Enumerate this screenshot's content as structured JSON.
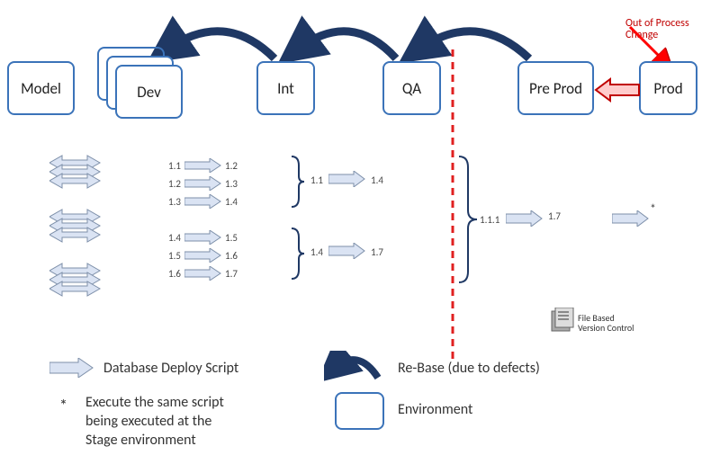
{
  "envs": {
    "model": "Model",
    "dev": "Dev",
    "int": "Int",
    "qa": "QA",
    "preprod": "Pre Prod",
    "prod": "Prod"
  },
  "oop": {
    "line1": "Out of Process",
    "line2": "Change"
  },
  "versions": {
    "g1": {
      "a_from": "1.1",
      "a_to": "1.2",
      "b_from": "1.2",
      "b_to": "1.3",
      "c_from": "1.3",
      "c_to": "1.4"
    },
    "g2": {
      "a_from": "1.4",
      "a_to": "1.5",
      "b_from": "1.5",
      "b_to": "1.6",
      "c_from": "1.6",
      "c_to": "1.7"
    },
    "int1": {
      "from": "1.1",
      "to": "1.4"
    },
    "int2": {
      "from": "1.4",
      "to": "1.7"
    },
    "qa": {
      "from": "1.1.1",
      "to": "1.7"
    },
    "prod": {
      "star": "*"
    }
  },
  "legend": {
    "deploy": "Database Deploy Script",
    "star1": "Execute the same script",
    "star2": "being executed at the",
    "star3": "Stage environment",
    "star_sym": "*",
    "rebase": "Re-Base (due to defects)",
    "environment": "Environment"
  },
  "vc": {
    "l1": "File Based",
    "l2": "Version Control"
  }
}
